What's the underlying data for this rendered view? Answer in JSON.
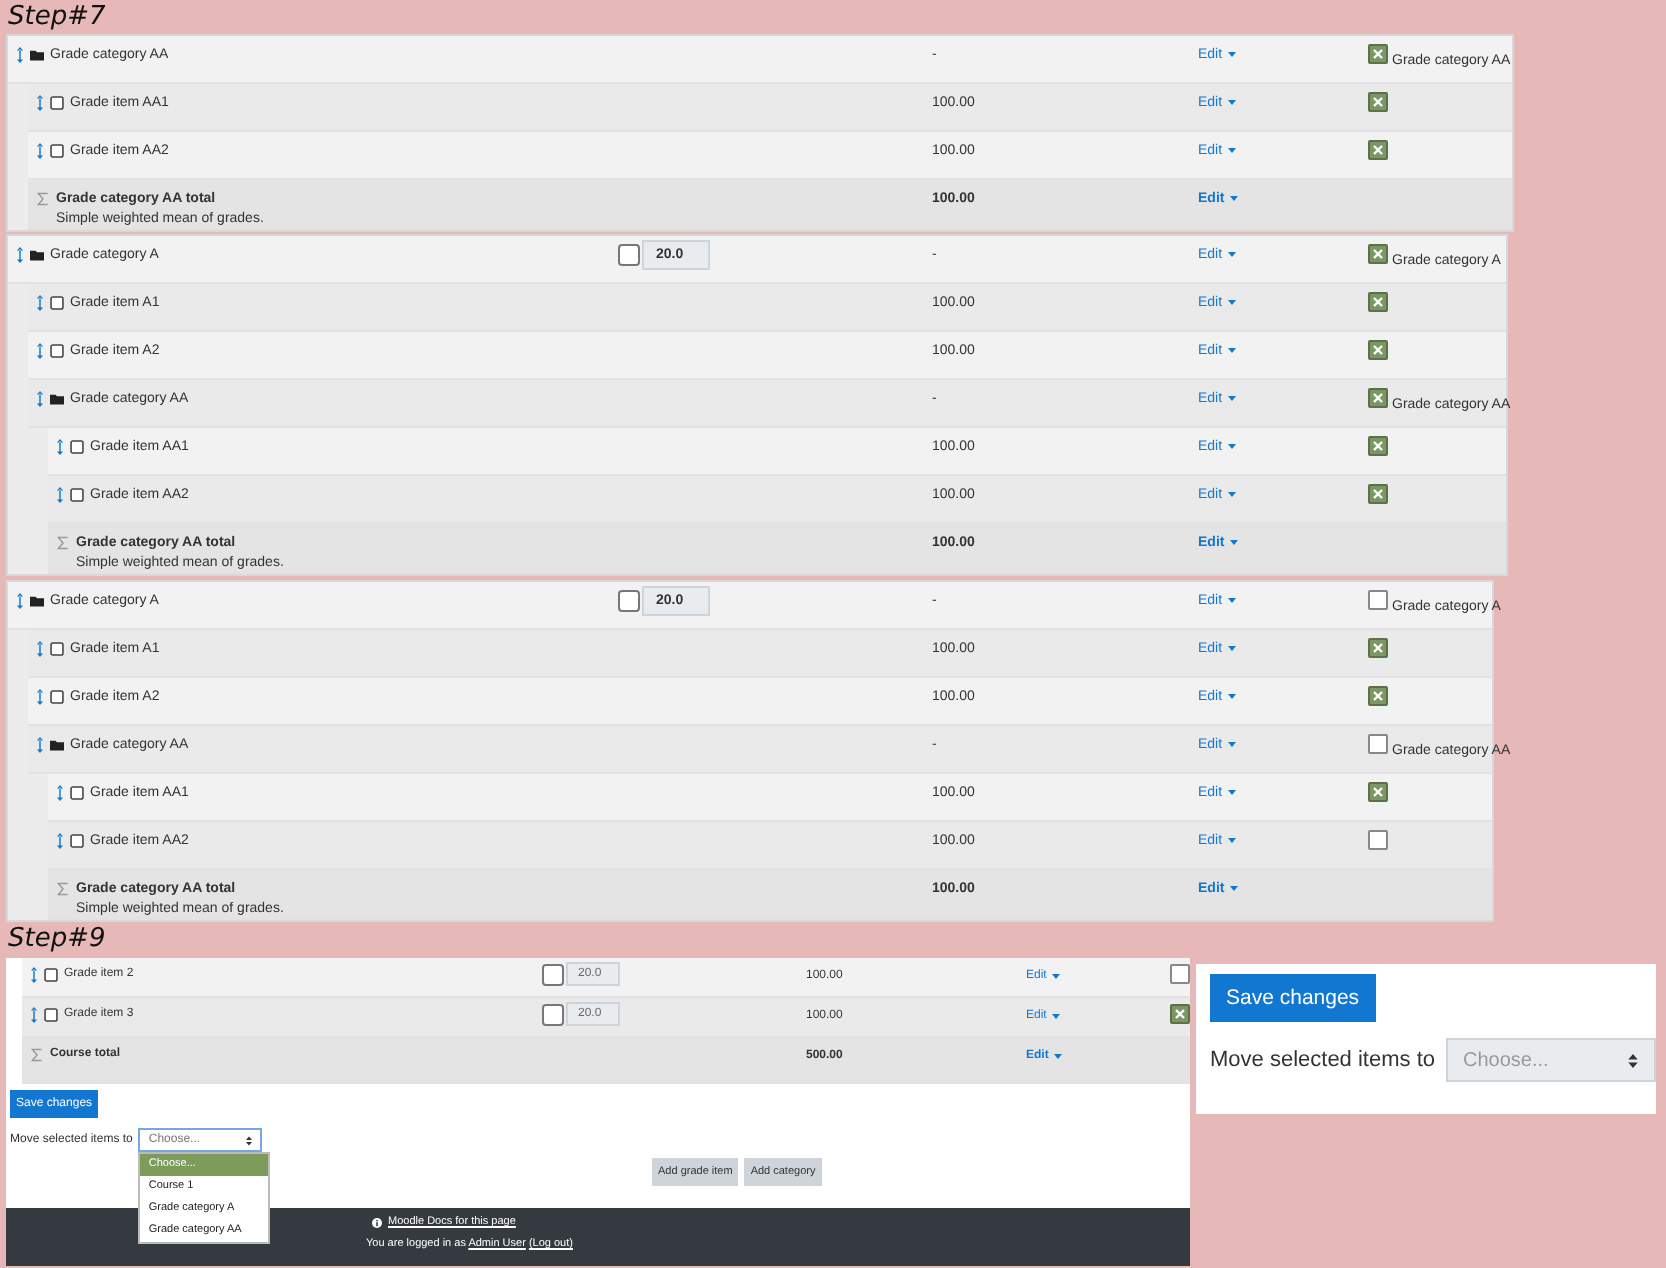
{
  "step_7": {
    "label": "Step#7",
    "tables": [
      {
        "rows": [
          {
            "kind": "category",
            "name": "Grade category AA",
            "value": "-",
            "edit": "Edit",
            "select": {
              "checked": true,
              "label": "Grade category AA"
            },
            "children": [
              {
                "kind": "item",
                "name": "Grade item AA1",
                "value": "100.00",
                "edit": "Edit",
                "select": {
                  "checked": true
                }
              },
              {
                "kind": "item",
                "name": "Grade item AA2",
                "value": "100.00",
                "edit": "Edit",
                "select": {
                  "checked": true
                }
              },
              {
                "kind": "total",
                "name": "Grade category AA total",
                "note": "Simple weighted mean of grades.",
                "value": "100.00",
                "edit": "Edit"
              }
            ]
          }
        ]
      },
      {
        "rows": [
          {
            "kind": "category",
            "name": "Grade category A",
            "weight": {
              "checked": false,
              "value": "20.0"
            },
            "value": "-",
            "edit": "Edit",
            "select": {
              "checked": true,
              "label": "Grade category A"
            },
            "children": [
              {
                "kind": "item",
                "name": "Grade item A1",
                "value": "100.00",
                "edit": "Edit",
                "select": {
                  "checked": true
                }
              },
              {
                "kind": "item",
                "name": "Grade item A2",
                "value": "100.00",
                "edit": "Edit",
                "select": {
                  "checked": true
                }
              },
              {
                "kind": "category",
                "name": "Grade category AA",
                "value": "-",
                "edit": "Edit",
                "select": {
                  "checked": true,
                  "label": "Grade category AA"
                },
                "children": [
                  {
                    "kind": "item",
                    "name": "Grade item AA1",
                    "value": "100.00",
                    "edit": "Edit",
                    "select": {
                      "checked": true
                    }
                  },
                  {
                    "kind": "item",
                    "name": "Grade item AA2",
                    "value": "100.00",
                    "edit": "Edit",
                    "select": {
                      "checked": true
                    }
                  },
                  {
                    "kind": "total",
                    "name": "Grade category AA total",
                    "note": "Simple weighted mean of grades.",
                    "value": "100.00",
                    "edit": "Edit"
                  }
                ]
              }
            ]
          }
        ]
      },
      {
        "rows": [
          {
            "kind": "category",
            "name": "Grade category A",
            "weight": {
              "checked": false,
              "value": "20.0"
            },
            "value": "-",
            "edit": "Edit",
            "select": {
              "checked": false,
              "label": "Grade category A"
            },
            "children": [
              {
                "kind": "item",
                "name": "Grade item A1",
                "value": "100.00",
                "edit": "Edit",
                "select": {
                  "checked": true
                }
              },
              {
                "kind": "item",
                "name": "Grade item A2",
                "value": "100.00",
                "edit": "Edit",
                "select": {
                  "checked": true
                }
              },
              {
                "kind": "category",
                "name": "Grade category AA",
                "value": "-",
                "edit": "Edit",
                "select": {
                  "checked": false,
                  "label": "Grade category AA"
                },
                "children": [
                  {
                    "kind": "item",
                    "name": "Grade item AA1",
                    "value": "100.00",
                    "edit": "Edit",
                    "select": {
                      "checked": true
                    }
                  },
                  {
                    "kind": "item",
                    "name": "Grade item AA2",
                    "value": "100.00",
                    "edit": "Edit",
                    "select": {
                      "checked": false
                    }
                  },
                  {
                    "kind": "total",
                    "name": "Grade category AA total",
                    "note": "Simple weighted mean of grades.",
                    "value": "100.00",
                    "edit": "Edit"
                  }
                ]
              }
            ]
          }
        ]
      }
    ]
  },
  "step_9": {
    "label": "Step#9",
    "course_panel": {
      "rows": [
        {
          "kind": "item",
          "name": "Grade item 2",
          "weight": {
            "checked": false,
            "value": "20.0"
          },
          "value": "100.00",
          "edit": "Edit",
          "select": {
            "checked": false
          }
        },
        {
          "kind": "item",
          "name": "Grade item 3",
          "weight": {
            "checked": false,
            "value": "20.0"
          },
          "value": "100.00",
          "edit": "Edit",
          "select": {
            "checked": true
          }
        },
        {
          "kind": "total",
          "name": "Course total",
          "value": "500.00",
          "edit": "Edit"
        }
      ],
      "save_button": "Save changes",
      "move_label": "Move selected items to",
      "move_select": {
        "value": "Choose...",
        "expanded": true,
        "options": [
          {
            "label": "Choose...",
            "selected": true
          },
          {
            "label": "Course 1",
            "selected": false
          },
          {
            "label": "Grade category A",
            "selected": false
          },
          {
            "label": "Grade category AA",
            "selected": false
          }
        ]
      },
      "buttons": [
        "Add grade item",
        "Add category"
      ],
      "footer": {
        "docs_link": "Moodle Docs for this page",
        "login_prefix": "You are logged in as",
        "user_link": "Admin User",
        "logout_link": "(Log out)"
      }
    },
    "summary_panel": {
      "save_button": "Save changes",
      "move_label": "Move selected items to",
      "move_select": {
        "value": "Choose..."
      }
    }
  }
}
